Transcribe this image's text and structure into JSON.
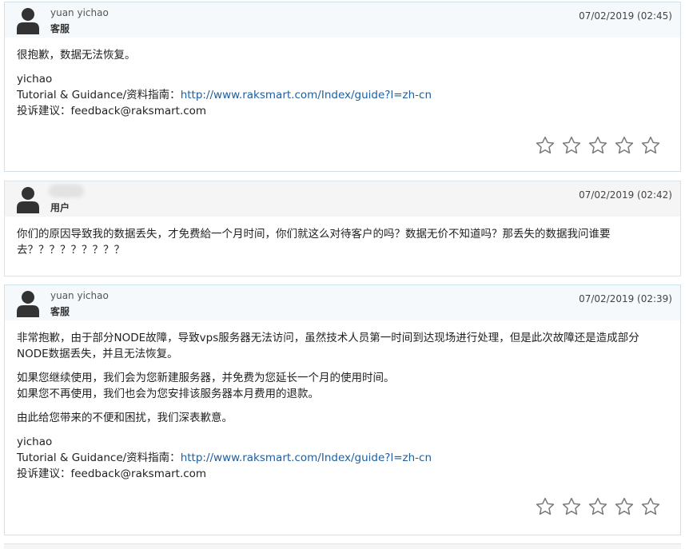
{
  "messages": [
    {
      "author": "yuan yichao",
      "role": "客服",
      "date": "07/02/2019 (02:45)",
      "body": [
        "很抱歉，数据无法恢复。"
      ],
      "signature": {
        "name": "yichao",
        "guide_label": "Tutorial & Guidance/资料指南：",
        "guide_link": "http://www.raksmart.com/Index/guide?l=zh-cn",
        "feedback": "投诉建议：feedback@raksmart.com"
      },
      "rating_stars": 5,
      "rating_value": 0
    },
    {
      "author": "",
      "role": "用户",
      "date": "07/02/2019 (02:42)",
      "body": [
        "你们的原因导致我的数据丢失，才免费給一个月时间，你们就这么对待客户的吗？数据无价不知道吗？那丢失的数据我问谁要去？？？？？？？？？"
      ]
    },
    {
      "author": "yuan yichao",
      "role": "客服",
      "date": "07/02/2019 (02:39)",
      "body": [
        "非常抱歉，由于部分NODE故障，导致vps服务器无法访问，虽然技术人员第一时间到达现场进行处理，但是此次故障还是造成部分NODE数据丢失，并且无法恢复。",
        "如果您继续使用，我们会为您新建服务器，并免费为您延长一个月的使用时间。",
        "如果您不再使用，我们也会为您安排该服务器本月费用的退款。",
        "由此给您带来的不便和困扰，我们深表歉意。"
      ],
      "signature": {
        "name": "yichao",
        "guide_label": "Tutorial & Guidance/资料指南：",
        "guide_link": "http://www.raksmart.com/Index/guide?l=zh-cn",
        "feedback": "投诉建议：feedback@raksmart.com"
      },
      "rating_stars": 5,
      "rating_value": 0
    }
  ],
  "icons": {
    "avatar": "user-silhouette-icon",
    "star": "star-outline-icon"
  },
  "colors": {
    "link": "#1e5fa0",
    "staff_header": "#f5f9fb",
    "client_header": "#f5f5f5"
  }
}
